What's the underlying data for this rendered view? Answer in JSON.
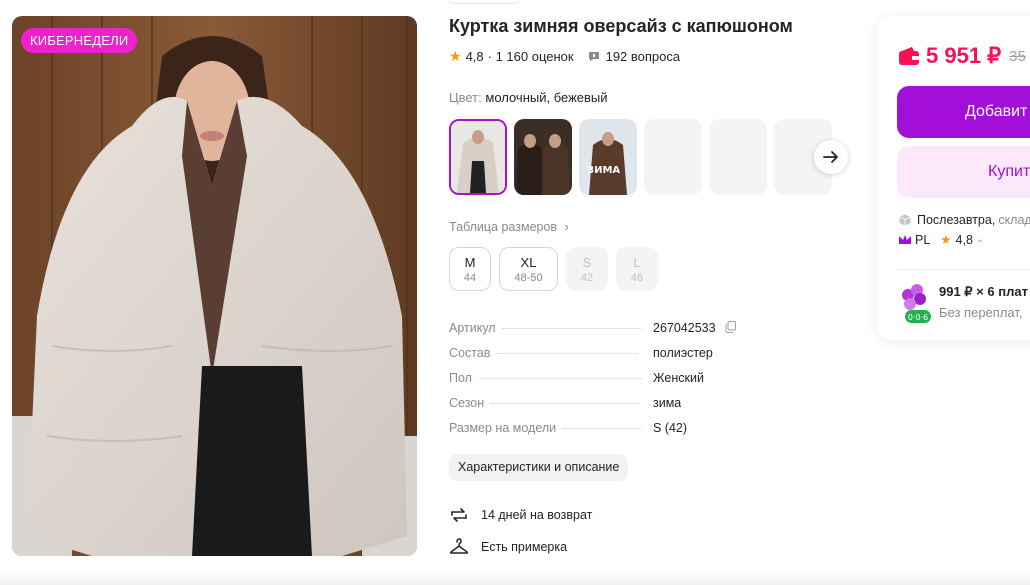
{
  "badge": "КИБЕРНЕДЕЛИ",
  "product": {
    "title": "Куртка зимняя оверсайз с капюшоном",
    "rating": "4,8",
    "reviews": "· 1 160 оценок",
    "questions": "192 вопроса"
  },
  "color": {
    "label": "Цвет:",
    "value": "молочный, бежевый",
    "thumb_caption": "ЗИМА"
  },
  "size_table_link": "Таблица размеров",
  "sizes": [
    {
      "main": "M",
      "sub": "44",
      "available": true
    },
    {
      "main": "XL",
      "sub": "48-50",
      "available": true
    },
    {
      "main": "S",
      "sub": "42",
      "available": false
    },
    {
      "main": "L",
      "sub": "46",
      "available": false
    }
  ],
  "specs": [
    {
      "key": "Артикул",
      "value": "267042533"
    },
    {
      "key": "Состав",
      "value": "полиэстер"
    },
    {
      "key": "Пол",
      "value": "Женский"
    },
    {
      "key": "Сезон",
      "value": "зима"
    },
    {
      "key": "Размер на модели",
      "value": "S (42)"
    }
  ],
  "chars_button": "Характеристики и описание",
  "features": {
    "return": "14 дней на возврат",
    "fitting": "Есть примерка"
  },
  "card": {
    "price": "5 951 ₽",
    "old_price": "35",
    "add_button": "Добавит",
    "buy_button": "Купит",
    "delivery_main": "Послезавтра,",
    "delivery_sub": "склад",
    "seller_name": "PL",
    "seller_rating": "4,8",
    "install_main": "991 ₽ × 6 плат",
    "install_sub": "Без переплат,",
    "install_badge": "0·0·6"
  },
  "colors": {
    "accent": "#a20fd8",
    "price": "#f91155",
    "badge": "#ee22cc",
    "star": "#f59b00"
  }
}
